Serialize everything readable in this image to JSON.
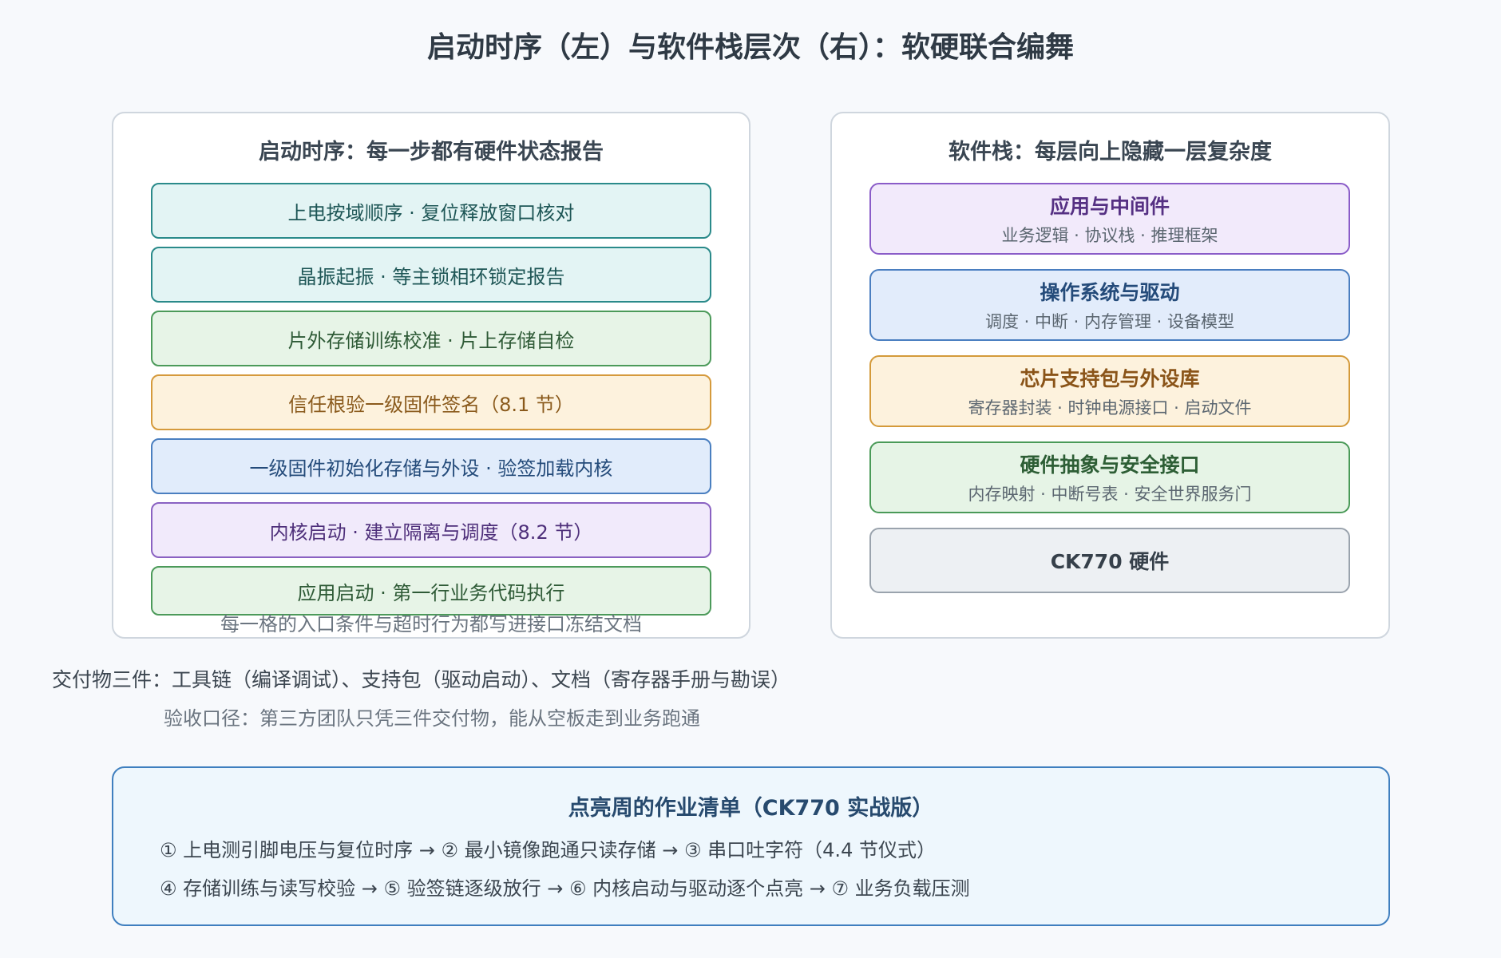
{
  "title": "启动时序（左）与软件栈层次（右）：软硬联合编舞",
  "left_panel": {
    "title": "启动时序：每一步都有硬件状态报告",
    "steps": [
      {
        "label": "上电按域顺序 · 复位释放窗口核对",
        "color": "teal"
      },
      {
        "label": "晶振起振 · 等主锁相环锁定报告",
        "color": "teal"
      },
      {
        "label": "片外存储训练校准 · 片上存储自检",
        "color": "green"
      },
      {
        "label": "信任根验一级固件签名（8.1 节）",
        "color": "orange"
      },
      {
        "label": "一级固件初始化存储与外设 · 验签加载内核",
        "color": "blue"
      },
      {
        "label": "内核启动 · 建立隔离与调度（8.2 节）",
        "color": "purple"
      },
      {
        "label": "应用启动 · 第一行业务代码执行",
        "color": "green"
      }
    ],
    "note": "每一格的入口条件与超时行为都写进接口冻结文档"
  },
  "right_panel": {
    "title": "软件栈：每层向上隐藏一层复杂度",
    "layers": [
      {
        "title": "应用与中间件",
        "subtitle": "业务逻辑 · 协议栈 · 推理框架",
        "color": "purple"
      },
      {
        "title": "操作系统与驱动",
        "subtitle": "调度 · 中断 · 内存管理 · 设备模型",
        "color": "blue"
      },
      {
        "title": "芯片支持包与外设库",
        "subtitle": "寄存器封装 · 时钟电源接口 · 启动文件",
        "color": "orange"
      },
      {
        "title": "硬件抽象与安全接口",
        "subtitle": "内存映射 · 中断号表 · 安全世界服务门",
        "color": "green"
      },
      {
        "title": "CK770 硬件",
        "subtitle": "",
        "color": "gray"
      }
    ]
  },
  "deliverables": "交付物三件：工具链（编译调试）、支持包（驱动启动）、文档（寄存器手册与勘误）",
  "acceptance": "验收口径：第三方团队只凭三件交付物，能从空板走到业务跑通",
  "checklist": {
    "title": "点亮周的作业清单（CK770 实战版）",
    "line1": "① 上电测引脚电压与复位时序 → ② 最小镜像跑通只读存储 → ③ 串口吐字符（4.4 节仪式）",
    "line2": "④ 存储训练与读写校验 → ⑤ 验签链逐级放行 → ⑥ 内核启动与驱动逐个点亮 → ⑦ 业务负载压测"
  }
}
